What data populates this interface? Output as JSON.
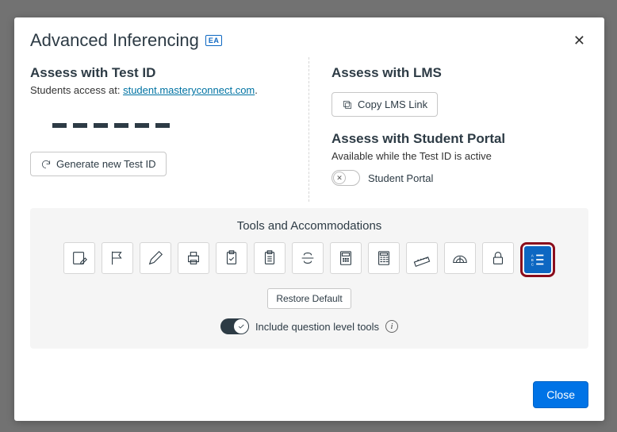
{
  "modal": {
    "title": "Advanced Inferencing",
    "badge": "EA"
  },
  "left": {
    "heading": "Assess with Test ID",
    "access_prefix": "Students access at: ",
    "access_link": "student.masteryconnect.com",
    "access_suffix": ".",
    "generate_label": "Generate new Test ID"
  },
  "right": {
    "lms_heading": "Assess with LMS",
    "copy_label": "Copy LMS Link",
    "portal_heading": "Assess with Student Portal",
    "portal_sub": "Available while the Test ID is active",
    "portal_toggle_label": "Student Portal"
  },
  "tools": {
    "heading": "Tools and Accommodations",
    "restore_label": "Restore Default",
    "qlt_label": "Include question level tools",
    "items": [
      {
        "name": "notepad-pencil"
      },
      {
        "name": "flag"
      },
      {
        "name": "pencil"
      },
      {
        "name": "printer"
      },
      {
        "name": "clipboard-check"
      },
      {
        "name": "clipboard-list"
      },
      {
        "name": "strikethrough"
      },
      {
        "name": "calculator-basic"
      },
      {
        "name": "calculator-scientific"
      },
      {
        "name": "ruler"
      },
      {
        "name": "protractor"
      },
      {
        "name": "lock"
      },
      {
        "name": "answer-choice-order",
        "highlighted": true
      }
    ]
  },
  "footer": {
    "close_label": "Close"
  }
}
